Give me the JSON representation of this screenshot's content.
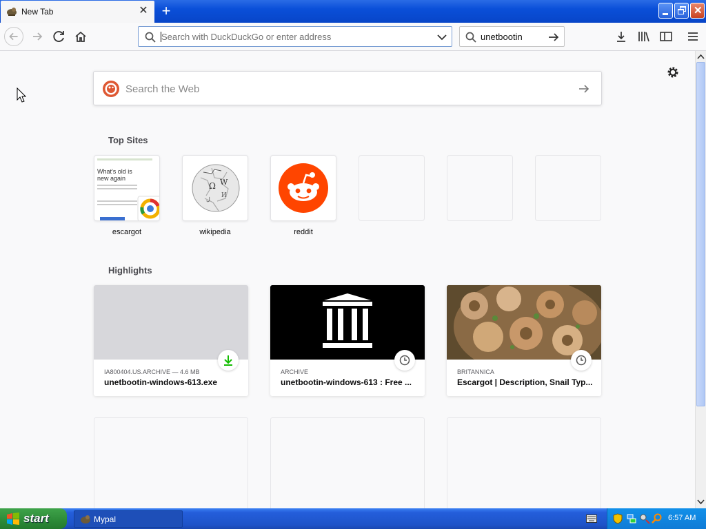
{
  "browser": {
    "tab_title": "New Tab",
    "url_placeholder": "Search with DuckDuckGo or enter address",
    "search_value": "unetbootin"
  },
  "newtab": {
    "web_search_placeholder": "Search the Web",
    "top_sites_title": "Top Sites",
    "top_sites": [
      {
        "label": "escargot",
        "preview_title": "What's old is new again"
      },
      {
        "label": "wikipedia"
      },
      {
        "label": "reddit"
      },
      {
        "label": ""
      },
      {
        "label": ""
      },
      {
        "label": ""
      }
    ],
    "highlights_title": "Highlights",
    "highlights": [
      {
        "source": "IA800404.US.ARCHIVE — 4.6 MB",
        "title": "unetbootin-windows-613.exe",
        "badge": "download-icon"
      },
      {
        "source": "ARCHIVE",
        "title": "unetbootin-windows-613 : Free ...",
        "badge": "clock-icon"
      },
      {
        "source": "BRITANNICA",
        "title": "Escargot | Description, Snail Typ...",
        "badge": "clock-icon"
      }
    ]
  },
  "taskbar": {
    "start_label": "start",
    "task_label": "Mypal",
    "clock": "6:57 AM"
  },
  "colors": {
    "reddit": "#ff4500",
    "duckduckgo": "#de5833",
    "download_green": "#12bc00"
  }
}
